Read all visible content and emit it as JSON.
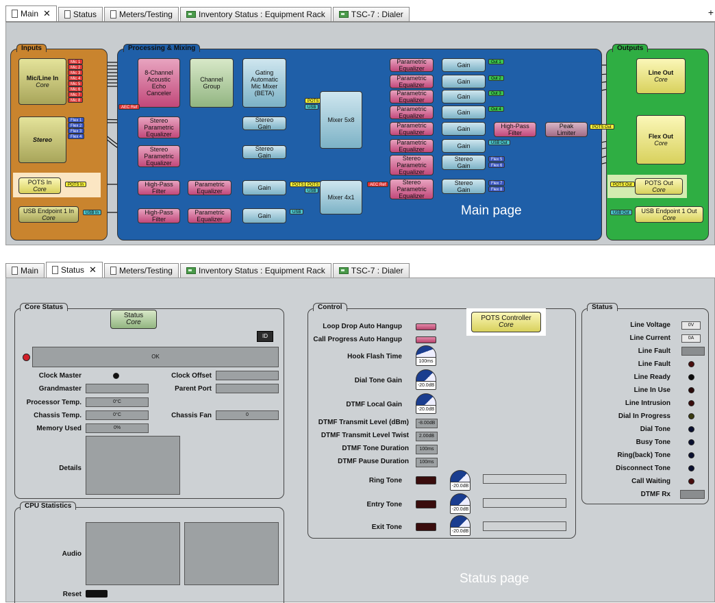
{
  "main": {
    "tabs": [
      {
        "label": "Main",
        "active": true,
        "closable": true,
        "icon": "doc-icon"
      },
      {
        "label": "Status",
        "active": false,
        "closable": false,
        "icon": "doc-icon"
      },
      {
        "label": "Meters/Testing",
        "active": false,
        "closable": false,
        "icon": "doc-icon"
      },
      {
        "label": "Inventory Status : Equipment Rack",
        "active": false,
        "closable": false,
        "icon": "uci-icon"
      },
      {
        "label": "TSC-7 : Dialer",
        "active": false,
        "closable": false,
        "icon": "uci-icon"
      }
    ],
    "add_tab": "+",
    "groups": {
      "inputs": "Inputs",
      "processing": "Processing & Mixing",
      "outputs": "Outputs"
    },
    "blocks": {
      "mic_line_in": [
        "Mic/Line In",
        "Core"
      ],
      "stereo_in": "Stereo",
      "pots_in": [
        "POTS In",
        "Core"
      ],
      "usb_in": [
        "USB Endpoint 1 In",
        "Core"
      ],
      "aec": [
        "8-Channel",
        "Acoustic",
        "Echo",
        "Canceler"
      ],
      "channel_group": [
        "Channel",
        "Group"
      ],
      "gating": [
        "Gating",
        "Automatic",
        "Mic Mixer",
        "(BETA)"
      ],
      "stereo_peq1": [
        "Stereo",
        "Parametric",
        "Equalizer"
      ],
      "stereo_peq2": [
        "Stereo",
        "Parametric",
        "Equalizer"
      ],
      "stereo_gain1": [
        "Stereo",
        "Gain"
      ],
      "stereo_gain2": [
        "Stereo",
        "Gain"
      ],
      "hpf1": [
        "High-Pass",
        "Filter"
      ],
      "peq_a": [
        "Parametric",
        "Equalizer"
      ],
      "gain_a": "Gain",
      "hpf2": [
        "High-Pass",
        "Filter"
      ],
      "peq_b": [
        "Parametric",
        "Equalizer"
      ],
      "gain_b": "Gain",
      "mixer5x8": "Mixer 5x8",
      "mixer4x1": "Mixer 4x1",
      "peq_out": [
        "Parametric",
        "Equalizer"
      ],
      "stereo_peq_out": [
        "Stereo",
        "Parametric",
        "Equalizer"
      ],
      "gain": "Gain",
      "stereo_gain": [
        "Stereo",
        "Gain"
      ],
      "hpf_out": [
        "High-Pass",
        "Filter"
      ],
      "peak": [
        "Peak",
        "Limiter"
      ],
      "line_out": [
        "Line Out",
        "Core"
      ],
      "flex_out": [
        "Flex Out",
        "Core"
      ],
      "pots_out": [
        "POTS Out",
        "Core"
      ],
      "usb_out": [
        "USB Endpoint 1 Out",
        "Core"
      ]
    },
    "pins": {
      "mic": [
        "Mic 1",
        "Mic 2",
        "Mic 3",
        "Mic 4",
        "Mic 5",
        "Mic 6",
        "Mic 7",
        "Mic 8"
      ],
      "flex": [
        "Flex 1",
        "Flex 2",
        "Flex 3",
        "Flex 4"
      ],
      "aec_ref": "AEC Ref",
      "pots_in": "POTS In",
      "usb_in": "USB In",
      "pots": "POTS",
      "usb": "USB",
      "out": [
        "Out 1",
        "Out 2",
        "Out 3",
        "Out 4"
      ],
      "usb_out": "USB Out",
      "flex5": "Flex 5",
      "flex6": "Flex 6",
      "flex7": "Flex 7",
      "flex8": "Flex 8",
      "pots_out": "POTS Out"
    },
    "caption": "Main page"
  },
  "status": {
    "tabs": [
      {
        "label": "Main",
        "active": false,
        "closable": false,
        "icon": "doc-icon"
      },
      {
        "label": "Status",
        "active": true,
        "closable": true,
        "icon": "doc-icon"
      },
      {
        "label": "Meters/Testing",
        "active": false,
        "closable": false,
        "icon": "doc-icon"
      },
      {
        "label": "Inventory Status : Equipment Rack",
        "active": false,
        "closable": false,
        "icon": "uci-icon"
      },
      {
        "label": "TSC-7 : Dialer",
        "active": false,
        "closable": false,
        "icon": "uci-icon"
      }
    ],
    "core_status": {
      "title": "Core Status",
      "status_block": [
        "Status",
        "Core"
      ],
      "id_button": "ID",
      "status_text": "OK",
      "clock_master": "Clock Master",
      "clock_offset": "Clock Offset",
      "grandmaster": "Grandmaster",
      "parent_port": "Parent Port",
      "processor_temp": "Processor Temp.",
      "processor_temp_value": "0°C",
      "chassis_temp": "Chassis Temp.",
      "chassis_temp_value": "0°C",
      "chassis_fan": "Chassis Fan",
      "chassis_fan_value": "0",
      "memory_used": "Memory Used",
      "memory_used_value": "0%",
      "details": "Details"
    },
    "cpu": {
      "title": "CPU Statistics",
      "audio": "Audio",
      "reset": "Reset"
    },
    "control": {
      "title": "Control",
      "pots_controller": [
        "POTS Controller",
        "Core"
      ],
      "loop_drop": "Loop Drop Auto Hangup",
      "call_progress": "Call Progress Auto Hangup",
      "hook_flash": "Hook Flash Time",
      "hook_flash_value": "100ms",
      "dial_tone_gain": "Dial Tone Gain",
      "dial_tone_gain_value": "-20.0dB",
      "dtmf_local_gain": "DTMF Local Gain",
      "dtmf_local_gain_value": "-20.0dB",
      "dtmf_tx_level": "DTMF Transmit Level (dBm)",
      "dtmf_tx_level_value": "-8.00dB",
      "dtmf_tx_twist": "DTMF Transmit Level Twist",
      "dtmf_tx_twist_value": "2.00dB",
      "dtmf_tone_duration": "DTMF Tone Duration",
      "dtmf_tone_duration_value": "100ms",
      "dtmf_pause_duration": "DTMF Pause Duration",
      "dtmf_pause_duration_value": "100ms",
      "ring_tone": "Ring Tone",
      "ring_tone_value": "-20.0dB",
      "entry_tone": "Entry Tone",
      "entry_tone_value": "-20.0dB",
      "exit_tone": "Exit Tone",
      "exit_tone_value": "-20.0dB"
    },
    "status_panel": {
      "title": "Status",
      "line_voltage": "Line Voltage",
      "line_voltage_value": "0V",
      "line_current": "Line Current",
      "line_current_value": "0A",
      "line_fault_a": "Line Fault",
      "line_fault_b": "Line Fault",
      "line_ready": "Line Ready",
      "line_in_use": "Line In Use",
      "line_intrusion": "Line Intrusion",
      "dial_in_progress": "Dial In Progress",
      "dial_tone": "Dial Tone",
      "busy_tone": "Busy Tone",
      "ring_back": "Ring(back) Tone",
      "disconnect": "Disconnect Tone",
      "call_waiting": "Call Waiting",
      "dtmf_rx": "DTMF Rx"
    },
    "caption": "Status page"
  },
  "colors": {
    "accent_blue": "#1f5fa8",
    "inputs_orange": "#c9842e",
    "outputs_green": "#2fae43",
    "highlight": "#fbf0cf"
  }
}
